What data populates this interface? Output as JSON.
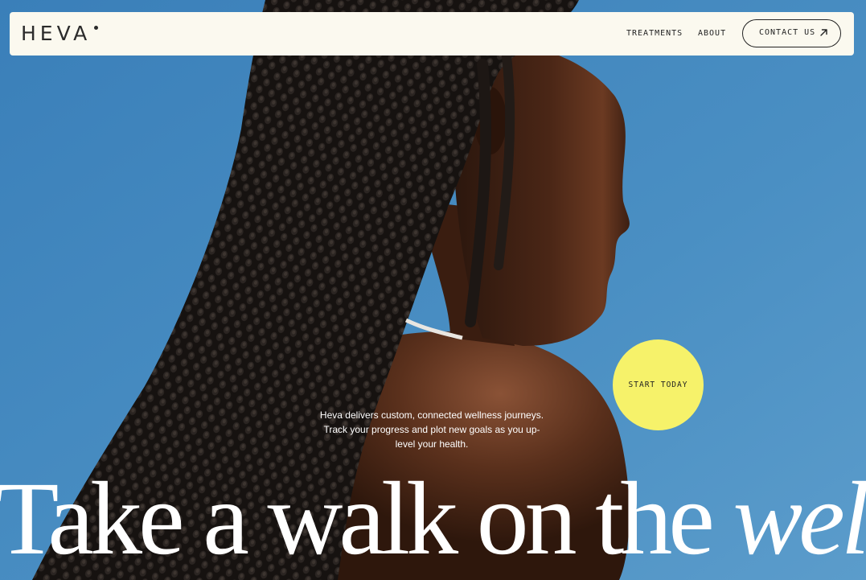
{
  "brand": {
    "logo_text": "HEVA"
  },
  "nav": {
    "links": [
      {
        "label": "TREATMENTS"
      },
      {
        "label": "ABOUT"
      }
    ],
    "contact_label": "CONTACT US",
    "contact_icon": "arrow-up-right-icon"
  },
  "hero": {
    "intro_text": "Heva delivers custom, connected wellness journeys. Track your progress and plot new goals as you up-level your health.",
    "cta_label": "START TODAY",
    "headline_regular": "Take a walk on the ",
    "headline_italic": "wellness"
  },
  "colors": {
    "sky": "#3f86bd",
    "nav_bg": "#fbf9ef",
    "cta_bg": "#f6f26a",
    "text_dark": "#222222",
    "headline": "#ffffff"
  }
}
